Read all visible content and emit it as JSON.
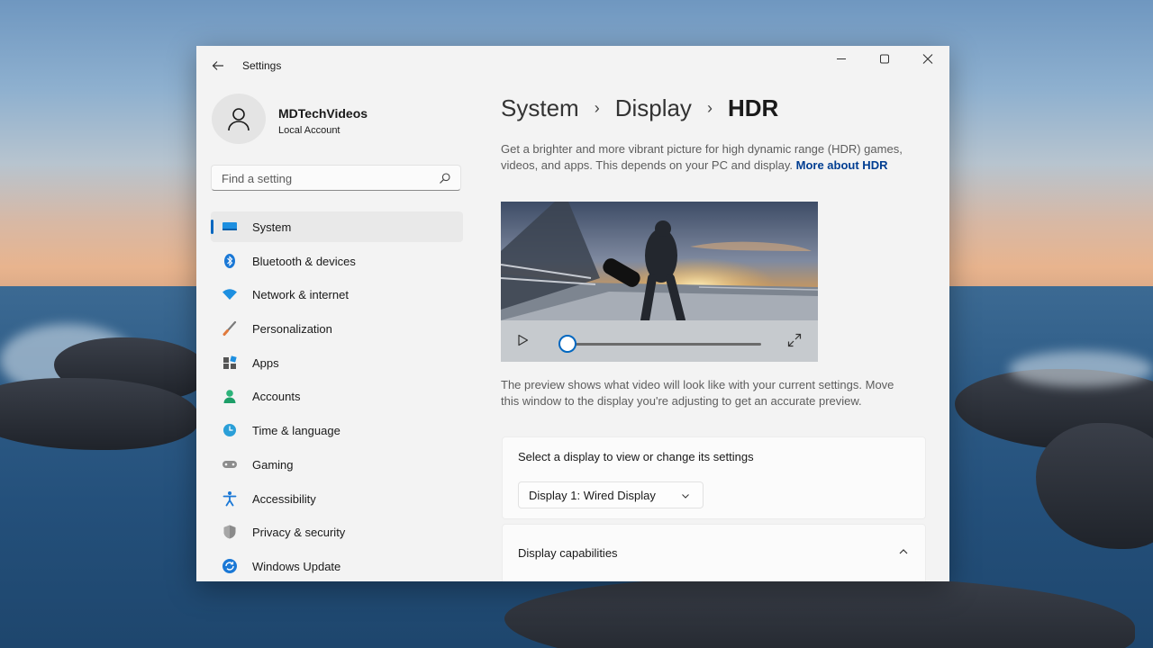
{
  "window": {
    "title": "Settings"
  },
  "account": {
    "name": "MDTechVideos",
    "type": "Local Account"
  },
  "search": {
    "placeholder": "Find a setting"
  },
  "sidebar": {
    "items": [
      {
        "label": "System",
        "icon": "system-icon",
        "active": true
      },
      {
        "label": "Bluetooth & devices",
        "icon": "bluetooth-icon"
      },
      {
        "label": "Network & internet",
        "icon": "wifi-icon"
      },
      {
        "label": "Personalization",
        "icon": "brush-icon"
      },
      {
        "label": "Apps",
        "icon": "apps-icon"
      },
      {
        "label": "Accounts",
        "icon": "person-icon"
      },
      {
        "label": "Time & language",
        "icon": "globe-clock-icon"
      },
      {
        "label": "Gaming",
        "icon": "gamepad-icon"
      },
      {
        "label": "Accessibility",
        "icon": "accessibility-icon"
      },
      {
        "label": "Privacy & security",
        "icon": "shield-icon"
      },
      {
        "label": "Windows Update",
        "icon": "update-icon"
      }
    ]
  },
  "breadcrumb": {
    "items": [
      "System",
      "Display",
      "HDR"
    ],
    "separator": "›"
  },
  "main": {
    "description": "Get a brighter and more vibrant picture for high dynamic range (HDR) games, videos, and apps. This depends on your PC and display.",
    "more_link": "More about HDR",
    "preview_note": "The preview shows what video will look like with your current settings. Move this window to the display you're adjusting to get an accurate preview.",
    "video": {
      "progress": 0.0
    }
  },
  "display_card": {
    "title": "Select a display to view or change its settings",
    "selected": "Display 1: Wired Display"
  },
  "capabilities_card": {
    "title": "Display capabilities"
  },
  "colors": {
    "accent": "#0067c0",
    "link": "#003e92",
    "window_bg": "#f3f3f3"
  }
}
